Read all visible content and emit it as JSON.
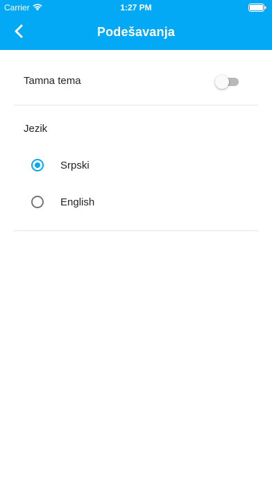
{
  "status_bar": {
    "carrier": "Carrier",
    "time": "1:27 PM",
    "wifi_icon": "wifi-icon",
    "battery_icon": "battery-full-icon"
  },
  "header": {
    "title": "Podešavanja",
    "back_icon": "chevron-left-icon",
    "background_color": "#03A9F4"
  },
  "settings": {
    "dark_theme": {
      "label": "Tamna tema",
      "enabled": false
    },
    "language": {
      "heading": "Jezik",
      "options": [
        {
          "label": "Srpski",
          "selected": true
        },
        {
          "label": "English",
          "selected": false
        }
      ]
    }
  },
  "colors": {
    "accent": "#03A9F4",
    "text": "#222222",
    "divider": "#e6e6e6",
    "radio_unselected": "#757575"
  }
}
